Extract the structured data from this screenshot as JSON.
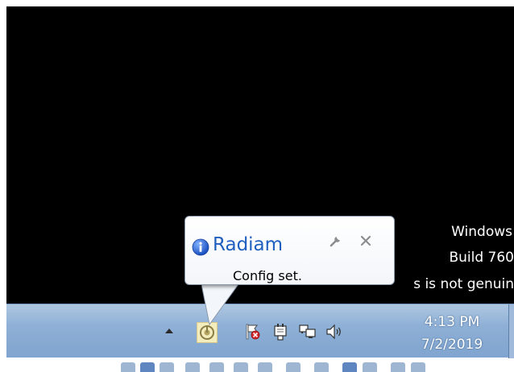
{
  "desktop": {
    "watermark": {
      "line1": "Windows",
      "line2": "Build 760",
      "line3": "s is not genuin"
    }
  },
  "notification": {
    "title": "Radiam",
    "message": "Config set.",
    "icon": "info-icon",
    "title_color": "#1f5fbf"
  },
  "taskbar": {
    "tray_icons": [
      "show-hidden-icons-arrow",
      "radiam-icon",
      "action-center-flag-icon",
      "power-plug-icon",
      "network-icon",
      "volume-icon"
    ],
    "clock": {
      "time": "4:13 PM",
      "date": "7/2/2019"
    }
  }
}
